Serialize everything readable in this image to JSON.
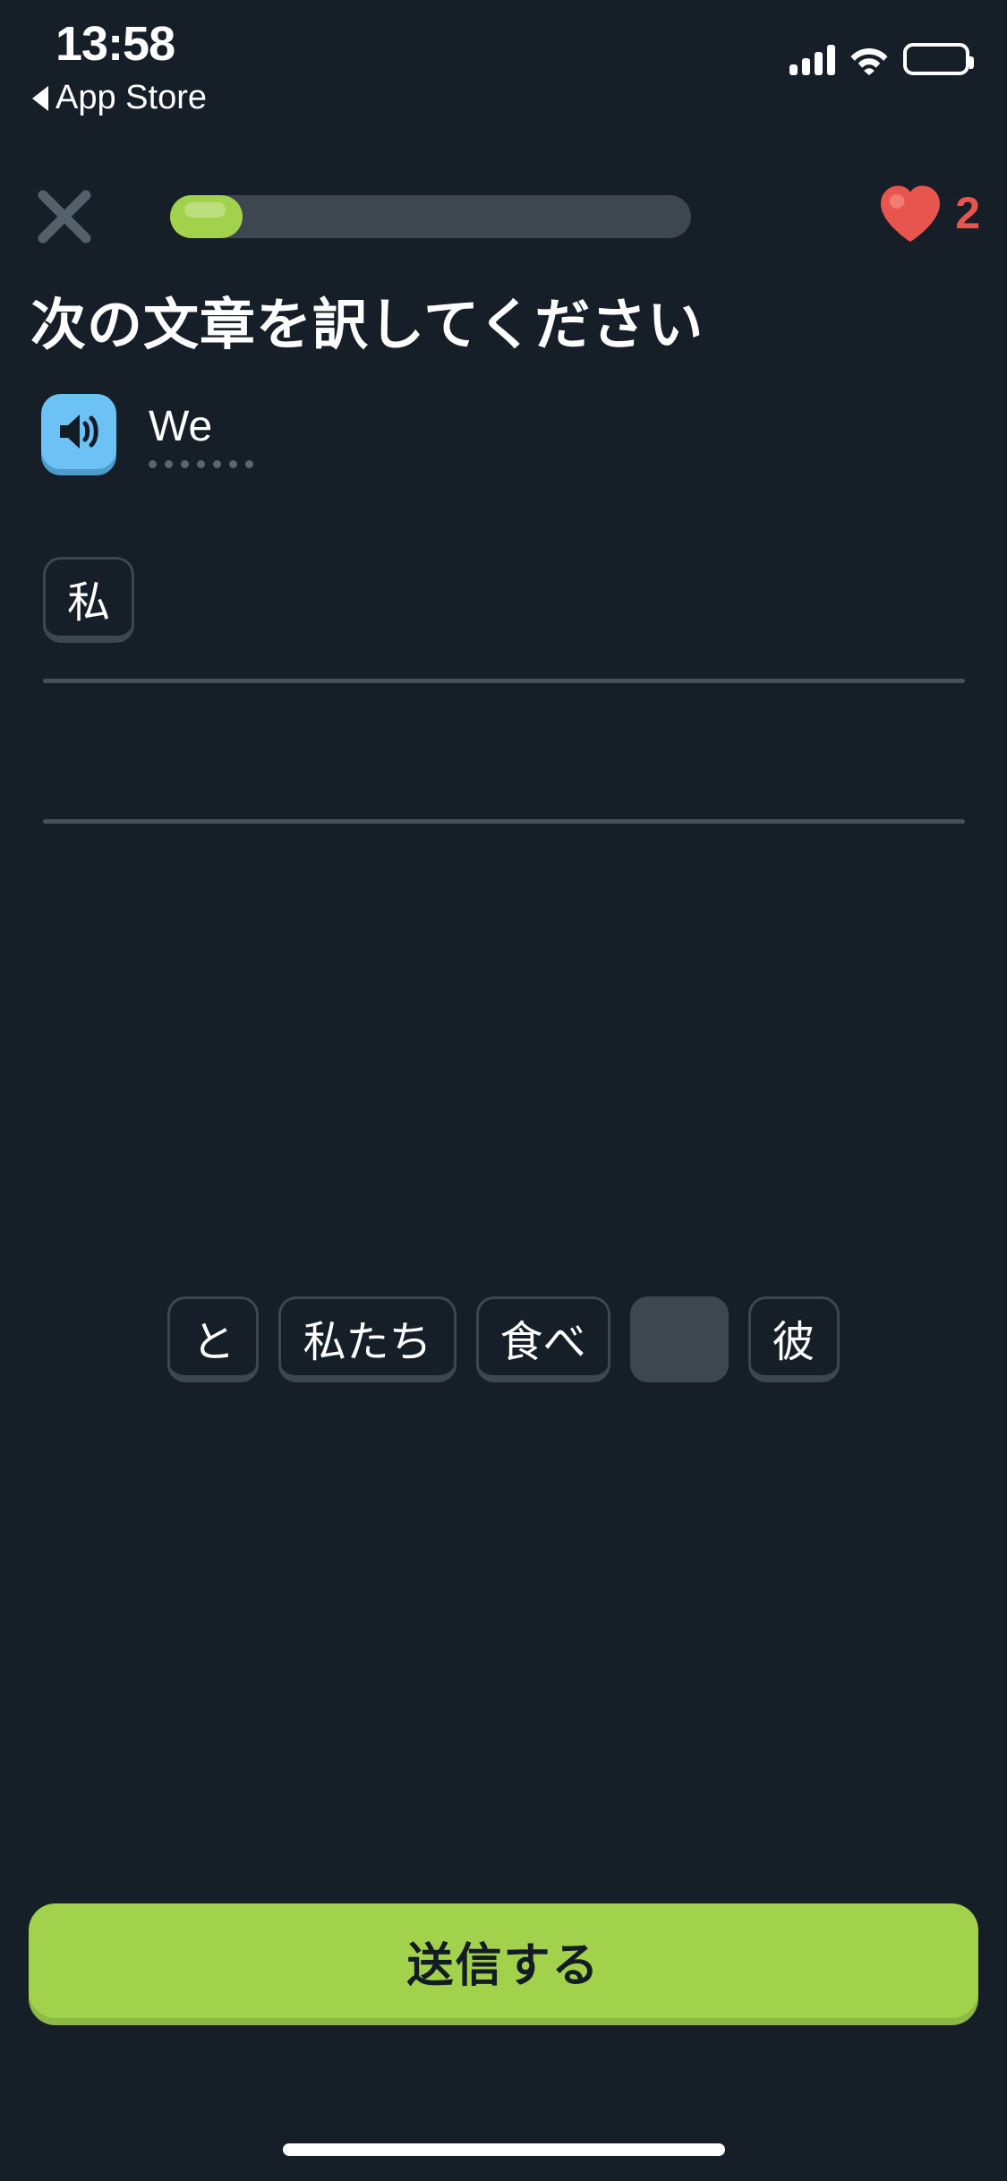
{
  "status_bar": {
    "time": "13:58",
    "back_label": "App Store",
    "back_icon": "triangle-left-icon",
    "signal_icon": "cellular-signal-icon",
    "wifi_icon": "wifi-icon",
    "battery_icon": "battery-full-icon"
  },
  "header": {
    "close_icon": "close-x-icon",
    "progress_percent": 14,
    "heart_icon": "heart-icon",
    "heart_count": "2",
    "colors": {
      "progress_fill": "#A2D14C",
      "progress_track": "#3C4750",
      "heart": "#E8554E",
      "close": "#53616B"
    }
  },
  "exercise": {
    "prompt_title": "次の文章を訳してください",
    "speaker_icon": "speaker-volume-icon",
    "source_text": "We",
    "source_text_dot_count": 7,
    "answer_lines": 2,
    "answer_tiles": [
      "私"
    ]
  },
  "word_bank": {
    "tiles": [
      {
        "label": "と",
        "used": false
      },
      {
        "label": "私たち",
        "used": false
      },
      {
        "label": "食べ",
        "used": false
      },
      {
        "label": "私",
        "used": true
      },
      {
        "label": "彼",
        "used": false
      }
    ]
  },
  "footer": {
    "submit_label": "送信する",
    "submit_color": "#A2D14C",
    "home_indicator": "home-indicator"
  },
  "theme": {
    "background": "#161F28",
    "tile_border": "#3C4750",
    "tile_fill": "#161F28",
    "line_color": "#465059",
    "speaker_blue": "#6DC2F5"
  }
}
